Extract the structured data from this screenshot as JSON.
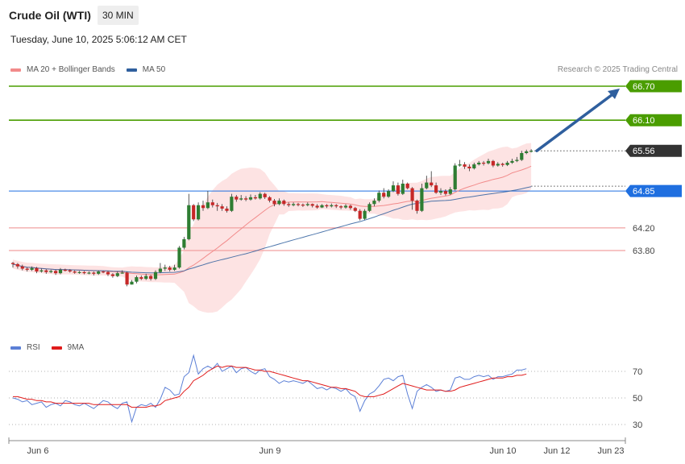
{
  "header": {
    "title": "Crude Oil (WTI)",
    "interval": "30 MIN",
    "timestamp": "Tuesday, June 10, 2025 5:06:12 AM CET",
    "copyright": "Research © 2025 Trading Central"
  },
  "legend_price": [
    {
      "label": "MA 20 + Bollinger Bands",
      "color": "#f28b8b"
    },
    {
      "label": "MA 50",
      "color": "#2f5f9e"
    }
  ],
  "legend_rsi": [
    {
      "label": "RSI",
      "color": "#5b7fd6"
    },
    {
      "label": "9MA",
      "color": "#e01b1b"
    }
  ],
  "colors": {
    "up": "#2e7d32",
    "down": "#c62828",
    "resistance": "#4a9d00",
    "support": "#f2a0a0",
    "pivot": "#1f6fe0",
    "last": "#333333",
    "arrow": "#2f5f9e",
    "band": "#fde0e0"
  },
  "chart_data": [
    {
      "type": "candlestick",
      "ylim": [
        63.55,
        66.9
      ],
      "x_ticks": [
        {
          "index": 5,
          "label": "Jun 6"
        },
        {
          "index": 53,
          "label": "Jun 9"
        },
        {
          "index": 101,
          "label": "Jun 10"
        },
        {
          "index": 113,
          "label": "Jun 12"
        },
        {
          "index": 125,
          "label": "Jun 23"
        }
      ],
      "levels": [
        {
          "value": 66.7,
          "label": "66.70",
          "role": "resistance"
        },
        {
          "value": 66.1,
          "label": "66.10",
          "role": "resistance"
        },
        {
          "value": 65.56,
          "label": "65.56",
          "role": "last"
        },
        {
          "value": 64.85,
          "label": "64.85",
          "role": "pivot"
        },
        {
          "value": 64.2,
          "label": "64.20",
          "role": "support"
        },
        {
          "value": 63.8,
          "label": "63.80",
          "role": "support"
        }
      ],
      "candles": [
        [
          63.58,
          63.56,
          63.6,
          63.5
        ],
        [
          63.56,
          63.52,
          63.58,
          63.48
        ],
        [
          63.52,
          63.48,
          63.55,
          63.45
        ],
        [
          63.48,
          63.46,
          63.5,
          63.43
        ],
        [
          63.46,
          63.49,
          63.52,
          63.44
        ],
        [
          63.49,
          63.43,
          63.51,
          63.4
        ],
        [
          63.43,
          63.45,
          63.48,
          63.41
        ],
        [
          63.45,
          63.42,
          63.47,
          63.39
        ],
        [
          63.42,
          63.44,
          63.46,
          63.4
        ],
        [
          63.44,
          63.4,
          63.46,
          63.37
        ],
        [
          63.4,
          63.46,
          63.49,
          63.38
        ],
        [
          63.46,
          63.45,
          63.48,
          63.43
        ],
        [
          63.45,
          63.43,
          63.47,
          63.41
        ],
        [
          63.43,
          63.41,
          63.45,
          63.39
        ],
        [
          63.41,
          63.42,
          63.44,
          63.39
        ],
        [
          63.42,
          63.4,
          63.44,
          63.38
        ],
        [
          63.4,
          63.41,
          63.43,
          63.38
        ],
        [
          63.41,
          63.39,
          63.43,
          63.36
        ],
        [
          63.39,
          63.43,
          63.45,
          63.37
        ],
        [
          63.43,
          63.42,
          63.44,
          63.4
        ],
        [
          63.42,
          63.38,
          63.44,
          63.35
        ],
        [
          63.38,
          63.35,
          63.4,
          63.32
        ],
        [
          63.35,
          63.4,
          63.43,
          63.33
        ],
        [
          63.4,
          63.41,
          63.45,
          63.39
        ],
        [
          63.41,
          63.2,
          63.43,
          63.17
        ],
        [
          63.2,
          63.25,
          63.28,
          63.2
        ],
        [
          63.25,
          63.33,
          63.36,
          63.22
        ],
        [
          63.33,
          63.3,
          63.36,
          63.28
        ],
        [
          63.3,
          63.35,
          63.39,
          63.28
        ],
        [
          63.35,
          63.3,
          63.37,
          63.27
        ],
        [
          63.3,
          63.42,
          63.45,
          63.28
        ],
        [
          63.42,
          63.48,
          63.58,
          63.4
        ],
        [
          63.48,
          63.5,
          63.55,
          63.44
        ],
        [
          63.5,
          63.46,
          63.53,
          63.43
        ],
        [
          63.46,
          63.5,
          63.55,
          63.44
        ],
        [
          63.5,
          63.85,
          63.88,
          63.48
        ],
        [
          63.85,
          64,
          64.04,
          63.82
        ],
        [
          64,
          64.6,
          64.8,
          63.98
        ],
        [
          64.6,
          64.35,
          64.62,
          64.32
        ],
        [
          64.35,
          64.6,
          64.65,
          64.33
        ],
        [
          64.6,
          64.55,
          64.68,
          64.5
        ],
        [
          64.55,
          64.65,
          64.85,
          64.53
        ],
        [
          64.65,
          64.6,
          64.7,
          64.56
        ],
        [
          64.6,
          64.58,
          64.64,
          64.5
        ],
        [
          64.58,
          64.54,
          64.62,
          64.5
        ],
        [
          64.54,
          64.5,
          64.58,
          64.47
        ],
        [
          64.5,
          64.75,
          64.8,
          64.48
        ],
        [
          64.75,
          64.7,
          64.78,
          64.66
        ],
        [
          64.7,
          64.72,
          64.78,
          64.68
        ],
        [
          64.72,
          64.7,
          64.76,
          64.67
        ],
        [
          64.7,
          64.74,
          64.79,
          64.68
        ],
        [
          64.74,
          64.72,
          64.78,
          64.7
        ],
        [
          64.72,
          64.8,
          64.83,
          64.7
        ],
        [
          64.8,
          64.74,
          64.82,
          64.71
        ],
        [
          64.74,
          64.68,
          64.76,
          64.65
        ],
        [
          64.68,
          64.62,
          64.71,
          64.58
        ],
        [
          64.62,
          64.68,
          64.72,
          64.6
        ],
        [
          64.68,
          64.62,
          64.7,
          64.59
        ],
        [
          64.62,
          64.6,
          64.65,
          64.57
        ],
        [
          64.6,
          64.62,
          64.65,
          64.58
        ],
        [
          64.62,
          64.61,
          64.64,
          64.58
        ],
        [
          64.61,
          64.6,
          64.63,
          64.57
        ],
        [
          64.6,
          64.62,
          64.65,
          64.58
        ],
        [
          64.62,
          64.59,
          64.63,
          64.56
        ],
        [
          64.59,
          64.56,
          64.62,
          64.54
        ],
        [
          64.56,
          64.6,
          64.62,
          64.55
        ],
        [
          64.6,
          64.58,
          64.62,
          64.55
        ],
        [
          64.58,
          64.6,
          64.63,
          64.56
        ],
        [
          64.6,
          64.58,
          64.62,
          64.55
        ],
        [
          64.58,
          64.56,
          64.6,
          64.53
        ],
        [
          64.56,
          64.59,
          64.62,
          64.54
        ],
        [
          64.59,
          64.55,
          64.61,
          64.52
        ],
        [
          64.55,
          64.5,
          64.57,
          64.48
        ],
        [
          64.5,
          64.36,
          64.53,
          64.33
        ],
        [
          64.36,
          64.5,
          64.53,
          64.34
        ],
        [
          64.5,
          64.62,
          64.65,
          64.48
        ],
        [
          64.62,
          64.68,
          64.72,
          64.58
        ],
        [
          64.68,
          64.82,
          64.86,
          64.65
        ],
        [
          64.82,
          64.75,
          64.9,
          64.72
        ],
        [
          64.75,
          64.85,
          64.88,
          64.73
        ],
        [
          64.85,
          64.95,
          65.02,
          64.83
        ],
        [
          64.95,
          64.8,
          65,
          64.77
        ],
        [
          64.8,
          64.98,
          65.05,
          64.78
        ],
        [
          64.98,
          64.9,
          65,
          64.88
        ],
        [
          64.9,
          64.68,
          64.92,
          64.52
        ],
        [
          64.68,
          64.5,
          64.7,
          64.45
        ],
        [
          64.5,
          64.9,
          64.98,
          64.48
        ],
        [
          64.9,
          65,
          65.12,
          64.88
        ],
        [
          65,
          64.95,
          65.2,
          64.92
        ],
        [
          64.95,
          64.82,
          65,
          64.8
        ],
        [
          64.82,
          64.85,
          64.9,
          64.78
        ],
        [
          64.85,
          64.8,
          64.88,
          64.77
        ],
        [
          64.8,
          64.88,
          64.92,
          64.78
        ],
        [
          64.88,
          65.3,
          65.34,
          64.86
        ],
        [
          65.3,
          65.32,
          65.4,
          65.28
        ],
        [
          65.32,
          65.28,
          65.36,
          65.24
        ],
        [
          65.28,
          65.25,
          65.32,
          65.2
        ],
        [
          65.25,
          65.32,
          65.35,
          65.23
        ],
        [
          65.32,
          65.35,
          65.38,
          65.3
        ],
        [
          65.35,
          65.34,
          65.38,
          65.3
        ],
        [
          65.34,
          65.38,
          65.42,
          65.32
        ],
        [
          65.38,
          65.3,
          65.4,
          65.27
        ],
        [
          65.3,
          65.33,
          65.36,
          65.28
        ],
        [
          65.33,
          65.31,
          65.35,
          65.28
        ],
        [
          65.31,
          65.35,
          65.38,
          65.29
        ],
        [
          65.35,
          65.38,
          65.42,
          65.33
        ],
        [
          65.38,
          65.4,
          65.45,
          65.36
        ],
        [
          65.4,
          65.52,
          65.56,
          65.38
        ],
        [
          65.52,
          65.55,
          65.58,
          65.5
        ],
        [
          65.55,
          65.56,
          65.59,
          65.53
        ]
      ]
    },
    {
      "type": "line",
      "ylim": [
        18,
        88
      ],
      "y_ticks": [
        30,
        50,
        70
      ],
      "series": [
        {
          "name": "RSI",
          "values": [
            50,
            49,
            47,
            48,
            45,
            46,
            47,
            43,
            45,
            46,
            44,
            48,
            47,
            45,
            44,
            46,
            44,
            42,
            45,
            48,
            47,
            44,
            42,
            46,
            47,
            32,
            43,
            45,
            44,
            46,
            43,
            49,
            58,
            56,
            52,
            53,
            66,
            69,
            82,
            68,
            72,
            74,
            72,
            76,
            70,
            72,
            74,
            69,
            72,
            73,
            70,
            68,
            71,
            72,
            66,
            64,
            61,
            63,
            62,
            63,
            62,
            61,
            63,
            60,
            57,
            58,
            56,
            58,
            57,
            55,
            57,
            53,
            51,
            40,
            48,
            53,
            55,
            59,
            64,
            65,
            63,
            66,
            67,
            53,
            42,
            55,
            58,
            60,
            58,
            55,
            56,
            55,
            56,
            65,
            66,
            64,
            64,
            66,
            67,
            66,
            67,
            64,
            66,
            66,
            67,
            68,
            71,
            71,
            72
          ]
        },
        {
          "name": "9MA",
          "values": [
            51,
            51,
            50,
            49,
            49,
            48,
            48,
            47,
            47,
            46,
            46,
            46,
            46,
            46,
            46,
            46,
            46,
            45,
            45,
            45,
            45,
            45,
            45,
            45,
            45,
            43,
            43,
            43,
            43,
            44,
            44,
            45,
            48,
            49,
            50,
            51,
            55,
            58,
            63,
            65,
            67,
            70,
            72,
            74,
            73,
            74,
            74,
            73,
            73,
            73,
            72,
            71,
            71,
            70,
            70,
            69,
            68,
            67,
            66,
            65,
            64,
            63,
            63,
            62,
            61,
            60,
            59,
            58,
            58,
            57,
            57,
            56,
            55,
            52,
            51,
            51,
            51,
            52,
            53,
            55,
            57,
            59,
            61,
            60,
            59,
            58,
            57,
            56,
            56,
            56,
            56,
            55,
            55,
            56,
            58,
            59,
            60,
            61,
            62,
            63,
            64,
            65,
            65,
            65,
            66,
            66,
            67,
            67,
            68
          ]
        }
      ]
    }
  ]
}
